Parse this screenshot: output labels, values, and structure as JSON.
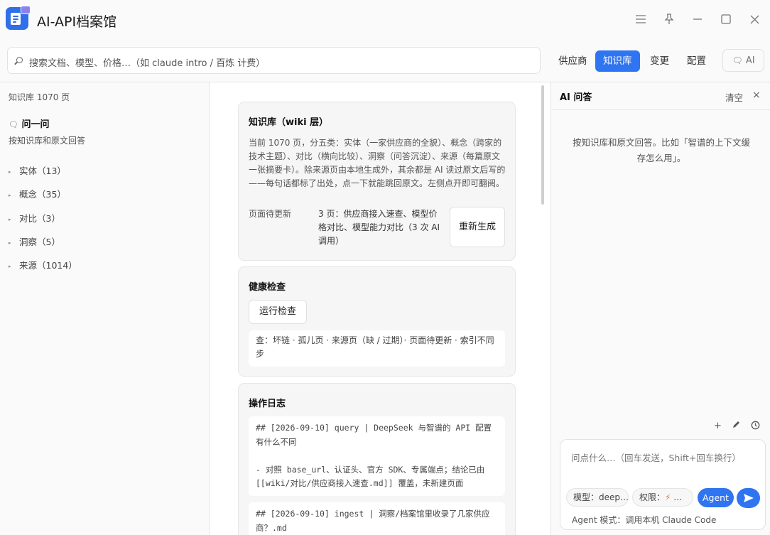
{
  "app": {
    "title": "AI-API档案馆"
  },
  "search": {
    "placeholder": "搜索文档、模型、价格…（如 claude intro / 百炼 计费）"
  },
  "nav": {
    "items": [
      "供应商",
      "知识库",
      "变更",
      "配置"
    ],
    "active": "知识库",
    "ai_label": "AI"
  },
  "sidebar": {
    "count": "知识库 1070 页",
    "ask_title": "问一问",
    "ask_subtitle": "按知识库和原文回答",
    "categories": [
      {
        "label": "实体（13）"
      },
      {
        "label": "概念（35）"
      },
      {
        "label": "对比（3）"
      },
      {
        "label": "洞察（5）"
      },
      {
        "label": "来源（1014）"
      }
    ]
  },
  "main": {
    "wiki_card": {
      "title": "知识库（wiki 层）",
      "description": "当前 1070 页，分五类：实体（一家供应商的全貌）、概念（跨家的技术主题）、对比（横向比较）、洞察（问答沉淀）、来源（每篇原文一张摘要卡）。除来源页由本地生成外，其余都是 AI 读过原文后写的——每句话都标了出处，点一下就能跳回原文。左侧点开即可翻阅。",
      "pending_label": "页面待更新",
      "pending_value": "3 页：供应商接入速查、模型价格对比、模型能力对比（3 次 AI 调用）",
      "regenerate_label": "重新生成"
    },
    "health_card": {
      "title": "健康检查",
      "run_label": "运行检查",
      "checks": "查：坏链 · 孤儿页 · 来源页（缺 / 过期）· 页面待更新 · 索引不同步"
    },
    "log_card": {
      "title": "操作日志",
      "entries": [
        {
          "text": "## [2026-09-10] query | DeepSeek 与智谱的 API 配置有什么不同\n\n- 对照 base_url、认证头、官方 SDK、专属端点；结论已由 [[wiki/对比/供应商接入速查.md]] 覆盖，未新建页面"
        },
        {
          "text": "## [2026-09-10] ingest | 洞察/档案馆里收录了几家供应商？.md"
        }
      ]
    }
  },
  "ai_panel": {
    "title": "AI 问答",
    "clear_label": "清空",
    "close_glyph": "×",
    "hint": "按知识库和原文回答。比如「智谱的上下文缓存怎么用」。",
    "input_placeholder": "问点什么…（回车发送，Shift+回车换行）",
    "model_label": "模型：deep…",
    "permission_label": "权限：",
    "permission_value": "…",
    "agent_label": "Agent",
    "mode_text": "Agent 模式：调用本机 Claude Code"
  },
  "colors": {
    "accent": "#2f74f0",
    "bolt": "#f5732a"
  }
}
